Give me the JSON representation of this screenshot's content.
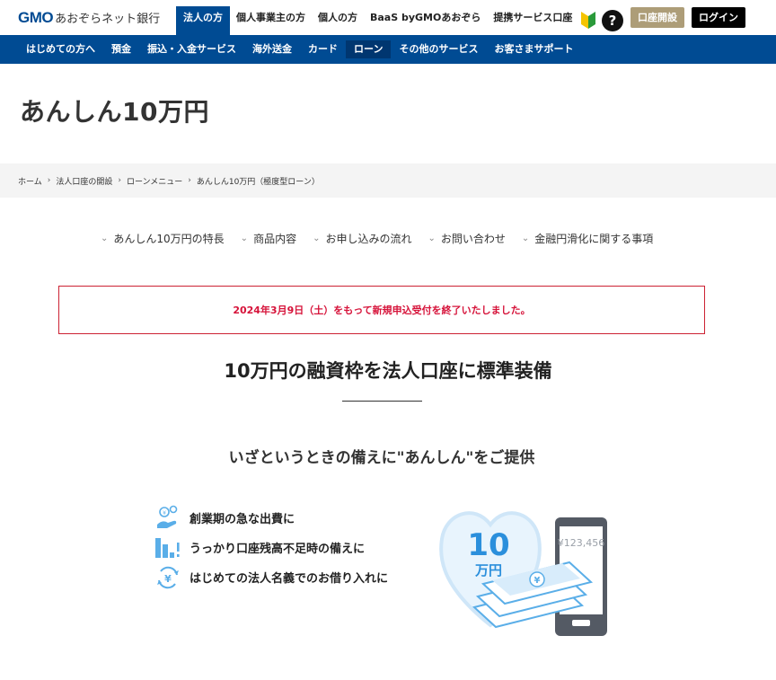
{
  "header": {
    "logo_gmo": "GMO",
    "logo_bank": "あおぞらネット銀行",
    "tabs": [
      {
        "label": "法人の方",
        "active": true
      },
      {
        "label": "個人事業主の方",
        "active": false
      },
      {
        "label": "個人の方",
        "active": false
      },
      {
        "label": "BaaS byGMOあおぞら",
        "active": false
      },
      {
        "label": "提携サービス口座",
        "active": false
      }
    ],
    "help_glyph": "?",
    "open_account_label": "口座開設",
    "login_label": "ログイン"
  },
  "nav": {
    "items": [
      "はじめての方へ",
      "預金",
      "振込・入金サービス",
      "海外送金",
      "カード",
      "ローン",
      "その他のサービス",
      "お客さまサポート"
    ],
    "current_index": 5
  },
  "page": {
    "title": "あんしん10万円"
  },
  "breadcrumb": [
    "ホーム",
    "法人口座の開設",
    "ローンメニュー",
    "あんしん10万円（極度型ローン）"
  ],
  "breadcrumb_separator": "›",
  "anchors": [
    "あんしん10万円の特長",
    "商品内容",
    "お申し込みの流れ",
    "お問い合わせ",
    "金融円滑化に関する事項"
  ],
  "notice": {
    "text": "2024年3月9日（土）をもって新規申込受付を終了いたしました。",
    "color": "#d6133a"
  },
  "headline": "10万円の融資枠を法人口座に標準装備",
  "subhead": "いざというときの備えに\"あんしん\"をご提供",
  "features": [
    {
      "icon": "coins-hand-icon",
      "text": "創業期の急な出費に"
    },
    {
      "icon": "bar-chart-exclamation-icon",
      "text": "うっかり口座残高不足時の備えに"
    },
    {
      "icon": "yen-cycle-icon",
      "text": "はじめての法人名義でのお借り入れに"
    }
  ],
  "illustration": {
    "heart_number": "10",
    "heart_unit": "万円",
    "phone_amount": "¥123,456"
  },
  "colors": {
    "brand_blue": "#004b93",
    "gold": "#ad9d78",
    "light_blue": "#5aaee8"
  }
}
